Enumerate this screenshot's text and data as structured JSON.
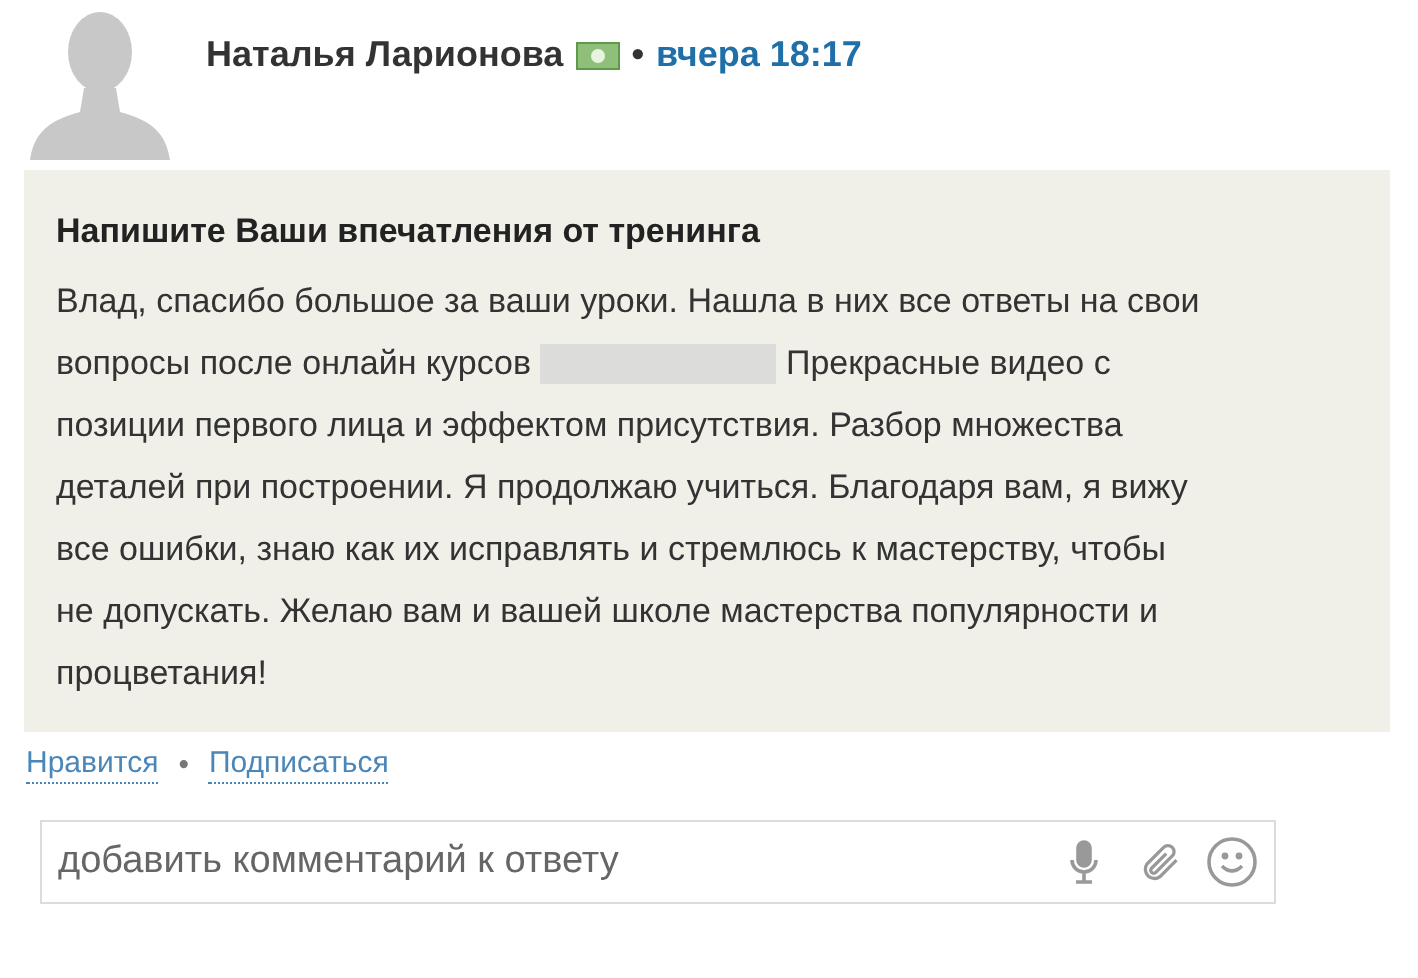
{
  "author": {
    "name": "Наталья Ларионова",
    "separator": "•",
    "time": "вчера 18:17"
  },
  "post": {
    "title": "Напишите Ваши впечатления от тренинга",
    "text_before": "Влад, спасибо большое за ваши уроки. Нашла в них все ответы на свои вопросы после онлайн курсов",
    "text_after": "Прекрасные видео с позиции первого лица и эффектом присутствия. Разбор множества деталей при построении. Я продолжаю учиться. Благодаря вам, я вижу все ошибки, знаю как их исправлять и стремлюсь к мастерству, чтобы не допускать. Желаю вам и вашей школе мастерства популярности и процветания!"
  },
  "actions": [
    {
      "label": "Нравится"
    },
    {
      "label": "Подписаться"
    }
  ],
  "action_separator": "•",
  "comment": {
    "placeholder": "добавить комментарий к ответу"
  }
}
